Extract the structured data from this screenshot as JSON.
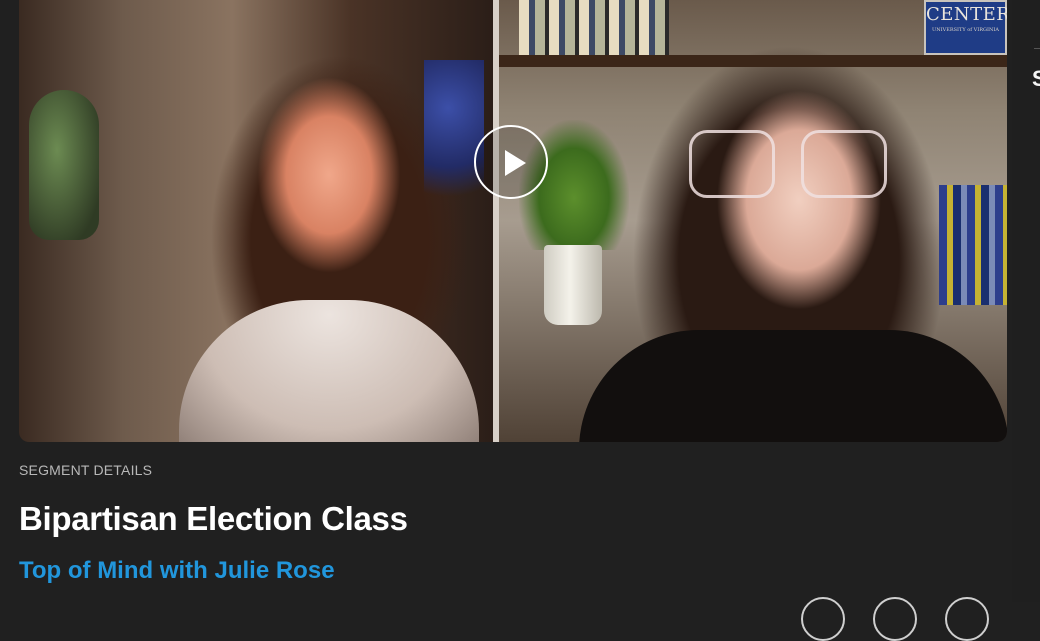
{
  "video": {
    "background_sign": {
      "main": "CENTER",
      "sub": "UNIVERSITY of VIRGINIA"
    },
    "play_icon": "play-icon"
  },
  "segment": {
    "eyebrow": "SEGMENT DETAILS",
    "title": "Bipartisan Election Class",
    "show": "Top of Mind with Julie Rose"
  },
  "side_panel": {
    "partial_letter": "S"
  },
  "colors": {
    "background": "#202020",
    "title": "#ffffff",
    "show_link": "#2196dc",
    "eyebrow": "#b8b8b8"
  }
}
